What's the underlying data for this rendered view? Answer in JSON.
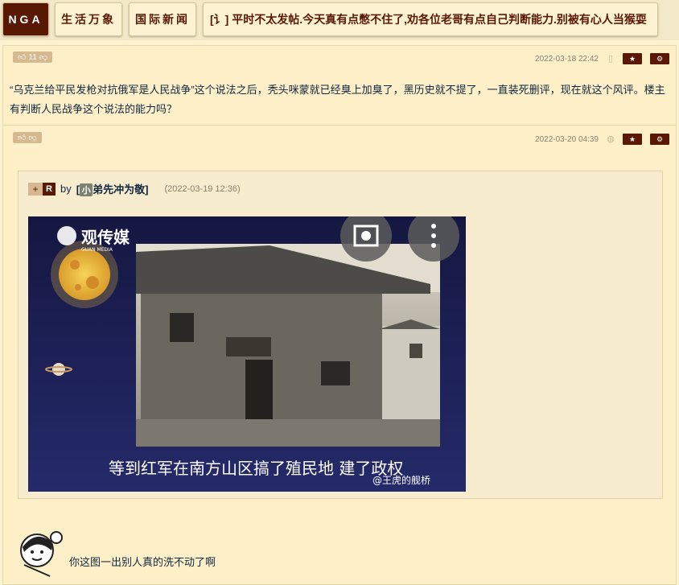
{
  "topbar": {
    "logo": "NGA",
    "tabs": [
      "生活万象",
      "国际新闻"
    ],
    "thread_title": "[讠] 平时不太发帖.今天真有点憋不住了,劝各位老哥有点自己判断能力.别被有心人当猴耍"
  },
  "post1": {
    "vote_count": "11",
    "timestamp": "2022-03-18 22:42",
    "body": "“乌克兰给平民发枪对抗俄军是人民战争”这个说法之后，秃头咪蒙就已经臭上加臭了，黑历史就不提了，一直装死删评，现在就这个风评。楼主有判断人民战争这个说法的能力吗？"
  },
  "post2": {
    "timestamp": "2022-03-20 04:39",
    "quote": {
      "plus": "+",
      "r": "R",
      "by": "by",
      "user_badge": "小",
      "user_name": "弟先冲为敬",
      "time": "(2022-03-19 12:36)"
    },
    "image": {
      "brand": "观传媒",
      "brand_sub": "GUAN MEDIA",
      "subtitle": "等到红军在南方山区搞了殖民地 建了政权",
      "watermark": "@王虎的舰桥"
    },
    "reply": "你这图一出别人真的洗不动了啊"
  },
  "colors": {
    "accent": "#591804",
    "background": "#fef3d1",
    "text": "#10273f"
  }
}
